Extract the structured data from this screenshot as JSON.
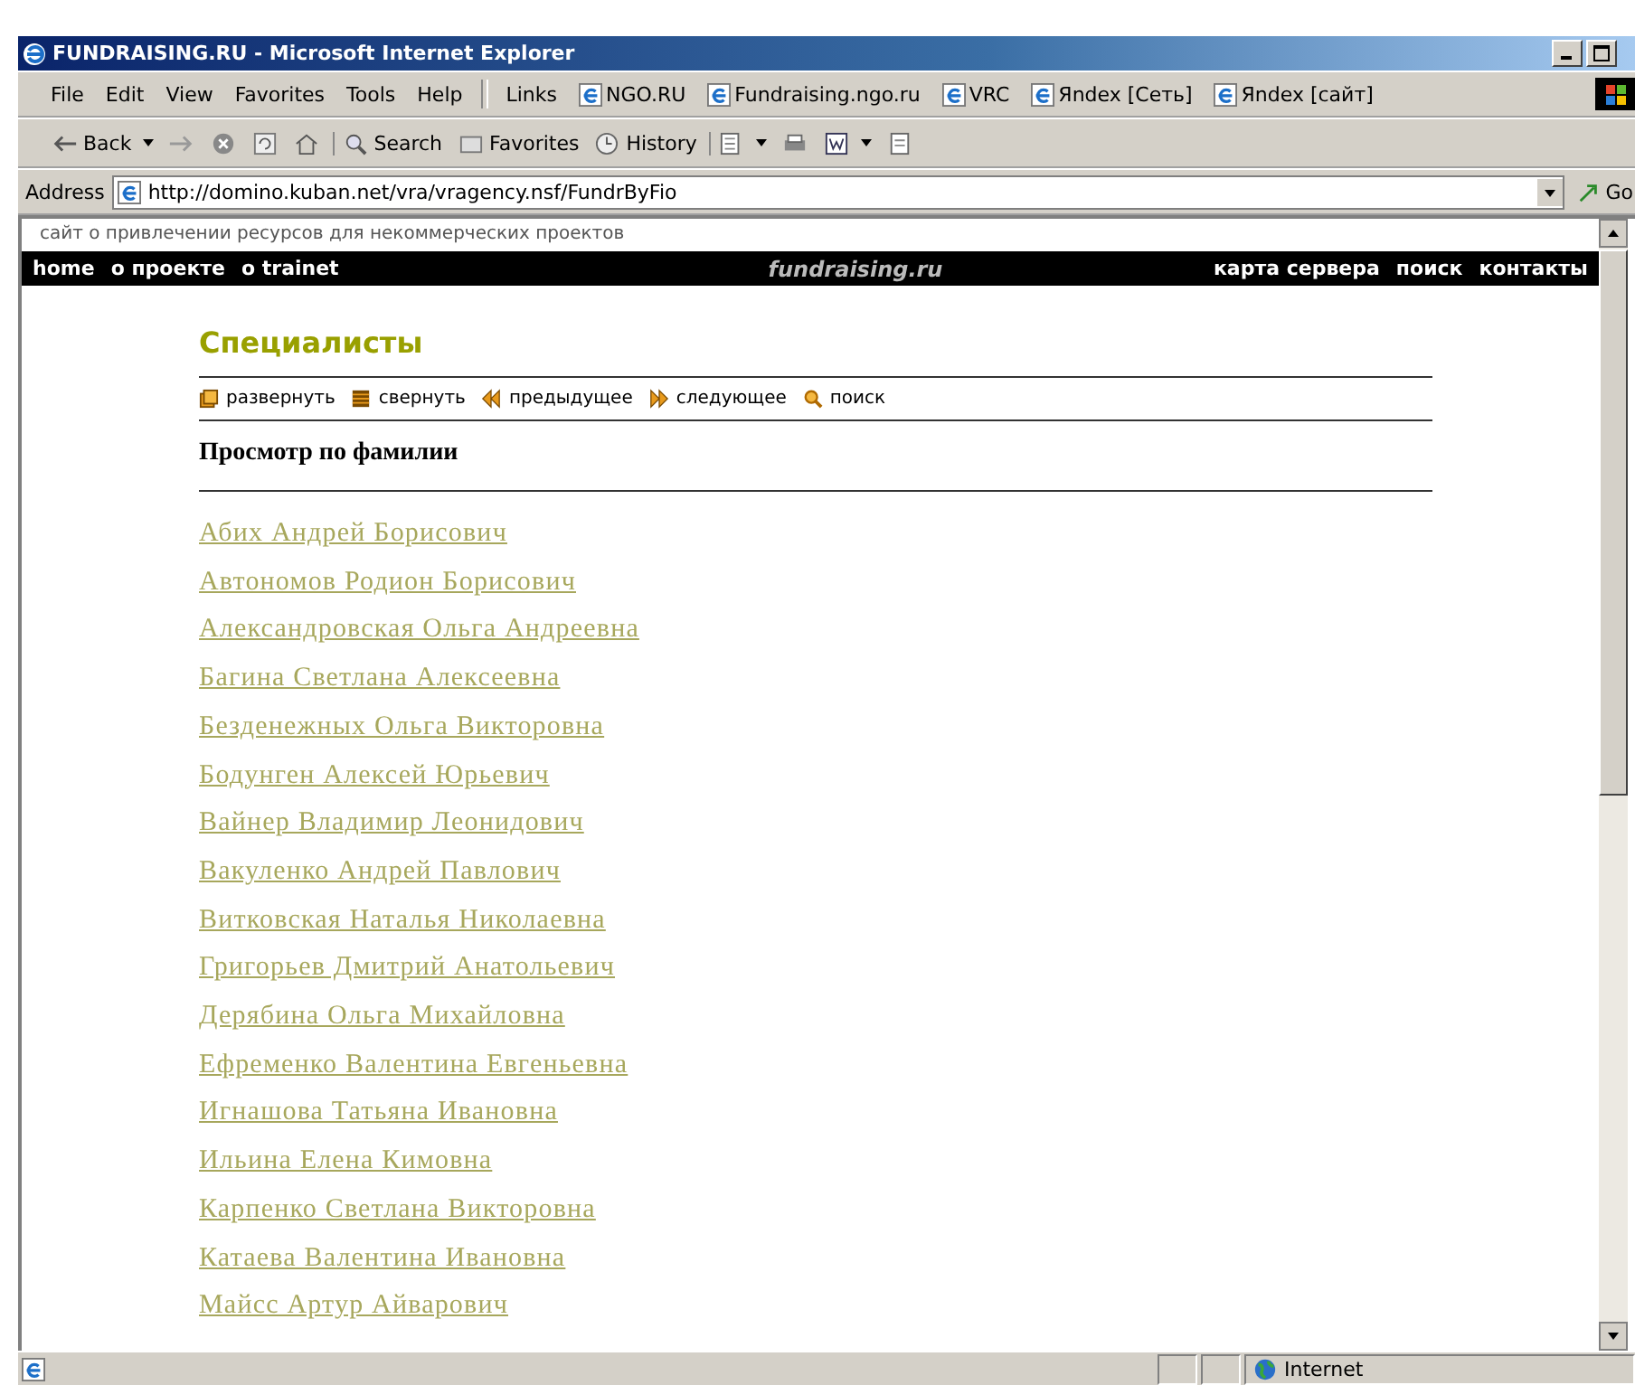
{
  "window": {
    "title": "FUNDRAISING.RU - Microsoft Internet Explorer"
  },
  "menu": [
    "File",
    "Edit",
    "View",
    "Favorites",
    "Tools",
    "Help"
  ],
  "links": {
    "label": "Links",
    "items": [
      "NGO.RU",
      "Fundraising.ngo.ru",
      "VRC",
      "Яndex [Сеть]",
      "Яndex [сайт]"
    ]
  },
  "toolbar": [
    {
      "kind": "back",
      "label": "Back"
    },
    {
      "kind": "forward"
    },
    {
      "kind": "stop"
    },
    {
      "kind": "refresh"
    },
    {
      "kind": "home"
    },
    {
      "kind": "search",
      "label": "Search"
    },
    {
      "kind": "favorites",
      "label": "Favorites"
    },
    {
      "kind": "history",
      "label": "History"
    },
    {
      "kind": "mail"
    },
    {
      "kind": "print"
    },
    {
      "kind": "word"
    },
    {
      "kind": "discuss"
    }
  ],
  "address": {
    "label": "Address",
    "value": "http://domino.kuban.net/vra/vragency.nsf/FundrByFio",
    "go": "Go"
  },
  "page": {
    "tagline": "сайт о привлечении ресурсов для некоммерческих проектов",
    "nav_left": [
      "home",
      "о проекте",
      "o trainet"
    ],
    "logo": "fundraising.ru",
    "nav_right": [
      "карта сервера",
      "поиск",
      "контакты"
    ],
    "heading": "Специалисты",
    "actions": [
      {
        "kind": "expand",
        "label": "развернуть"
      },
      {
        "kind": "collapse",
        "label": "свернуть"
      },
      {
        "kind": "previous",
        "label": "предыдущее"
      },
      {
        "kind": "next",
        "label": "следующее"
      },
      {
        "kind": "search",
        "label": "поиск"
      }
    ],
    "subheading": "Просмотр по фамилии",
    "names": [
      "Абих Андрей Борисович",
      "Автономов Родион Борисович",
      "Александровская Ольга Андреевна",
      "Багина Светлана Алексеевна",
      "Безденежных Ольга Викторовна",
      "Бодунген Алексей Юрьевич",
      "Вайнер Владимир Леонидович",
      "Вакуленко Андрей Павлович",
      "Витковская Наталья Николаевна",
      "Григорьев Дмитрий Анатольевич",
      "Дерябина Ольга Михайловна",
      "Ефременко Валентина Евгеньевна",
      "Игнашова Татьяна Ивановна",
      "Ильина Елена Кимовна",
      "Карпенко Светлана Викторовна",
      "Катаева Валентина Ивановна",
      "Майсс Артур Айварович"
    ]
  },
  "status_bar": {
    "zone": "Internet"
  }
}
